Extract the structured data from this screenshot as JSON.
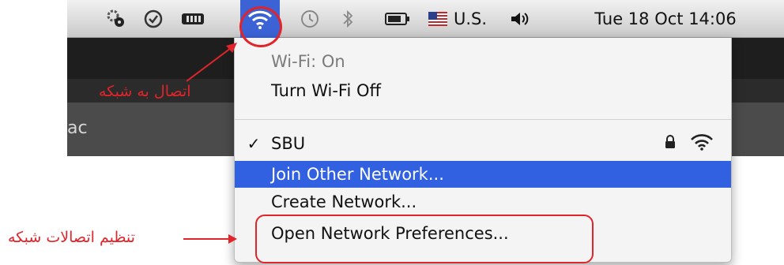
{
  "menubar": {
    "icons": [
      "settings-gears-icon",
      "checkmark-circle-icon",
      "battery-meter-icon",
      "wifi-icon",
      "time-machine-icon",
      "bluetooth-icon",
      "battery-icon",
      "us-flag-icon",
      "volume-icon"
    ],
    "input_source": "U.S.",
    "clock": "Tue 18 Oct  14:06"
  },
  "background": {
    "partial_text": "ac"
  },
  "wifi_menu": {
    "status": "Wi-Fi: On",
    "toggle": "Turn Wi-Fi Off",
    "network": {
      "name": "SBU",
      "check": "✓",
      "icons": [
        "lock-icon",
        "wifi-signal-icon"
      ]
    },
    "join_other": "Join Other Network...",
    "create": "Create Network...",
    "preferences": "Open Network Preferences..."
  },
  "annotations": {
    "connect_label": "اتصال به شبکه",
    "settings_label": "تنظیم اتصالات شبکه",
    "color": "#e0242a"
  }
}
